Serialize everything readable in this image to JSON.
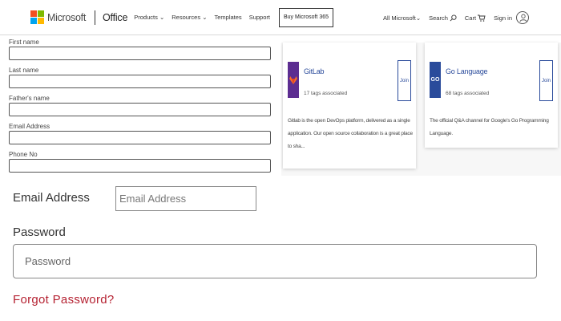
{
  "header": {
    "brand": "Microsoft",
    "product": "Office",
    "nav": [
      "Products",
      "Resources",
      "Templates",
      "Support"
    ],
    "buy_button": "Buy Microsoft 365",
    "all_microsoft": "All Microsoft",
    "search": "Search",
    "cart": "Cart",
    "sign_in": "Sign in",
    "logo_colors": [
      "#f25022",
      "#7fba00",
      "#00a4ef",
      "#ffb900"
    ]
  },
  "small_form": {
    "first_name_label": "First name",
    "last_name_label": "Last name",
    "fathers_name_label": "Father's name",
    "email_label": "Email Address",
    "phone_label": "Phone No"
  },
  "cards": [
    {
      "title": "GitLab",
      "subtitle": "17 tags associated",
      "description": "Gitlab is the open DevOps platform, delivered as a single application. Our open source collaboration is a great place to sha...",
      "button": "Join",
      "icon_color": "#5c2d91",
      "icon": "gitlab-fox-icon"
    },
    {
      "title": "Go Language",
      "subtitle": "68 tags associated",
      "description": "The official Q&A channel for Google's Go Programming Language.",
      "button": "Join",
      "icon_color": "#2a4b9b",
      "icon_text": "GO"
    }
  ],
  "login_form": {
    "email_label": "Email Address",
    "email_placeholder": "Email Address",
    "password_label": "Password",
    "password_placeholder": "Password",
    "forgot_link": "Forgot Password?",
    "accent_color": "#b52232"
  }
}
